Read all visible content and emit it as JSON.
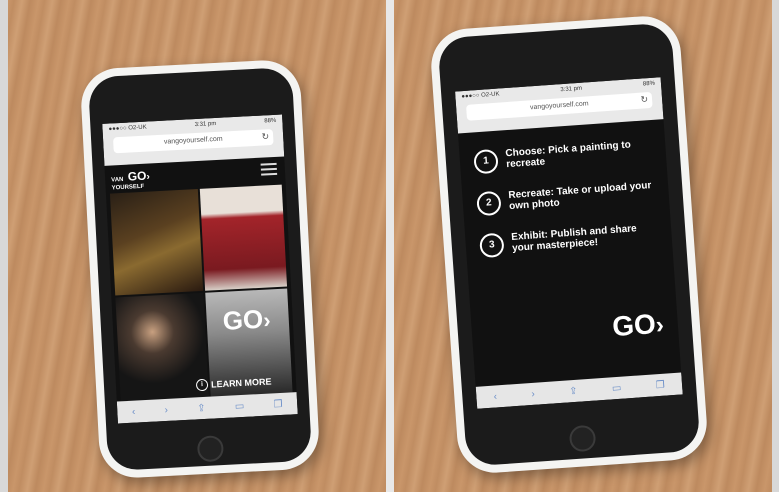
{
  "status": {
    "carrier": "●●●○○ O2-UK",
    "time": "3:31 pm",
    "battery": "88%"
  },
  "browser": {
    "url": "vangoyourself.com"
  },
  "left_screen": {
    "brand_small": "VAN",
    "brand_go": "GO",
    "brand_sub": "YOURSELF",
    "go_label": "GO",
    "learn_more": "LEARN MORE",
    "info_icon": "i"
  },
  "right_screen": {
    "steps": [
      {
        "num": "1",
        "title": "Choose:",
        "text": "Pick a painting to recreate"
      },
      {
        "num": "2",
        "title": "Recreate:",
        "text": "Take or upload your own photo"
      },
      {
        "num": "3",
        "title": "Exhibit:",
        "text": "Publish and share your masterpiece!"
      }
    ],
    "go_label": "GO"
  }
}
